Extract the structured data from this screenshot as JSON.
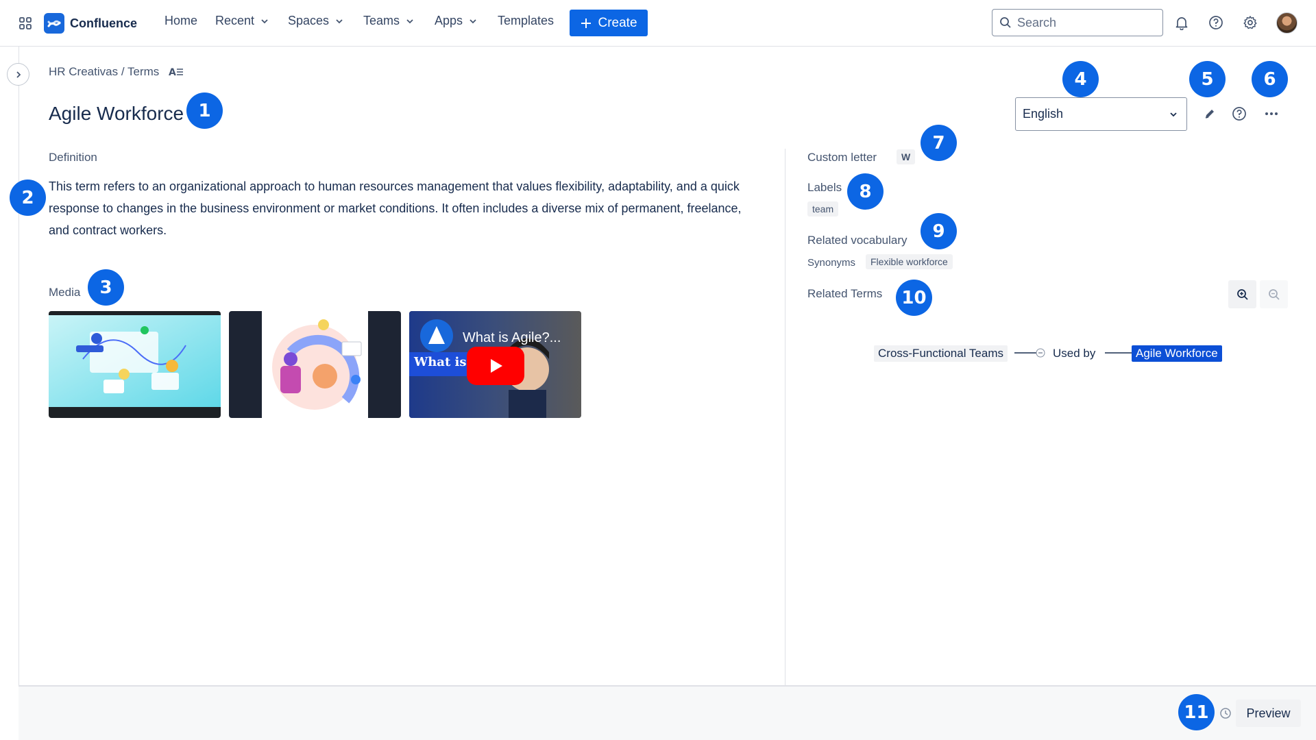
{
  "app": {
    "name": "Confluence"
  },
  "nav": {
    "home": "Home",
    "recent": "Recent",
    "spaces": "Spaces",
    "teams": "Teams",
    "apps": "Apps",
    "templates": "Templates",
    "create": "Create"
  },
  "search": {
    "placeholder": "Search"
  },
  "breadcrumb": {
    "space": "HR Creativas",
    "separator": "/",
    "page": "Terms"
  },
  "page": {
    "title": "Agile Workforce"
  },
  "definition": {
    "label": "Definition",
    "text": "This term refers to an organizational approach to human resources management that values flexibility, adaptability, and a quick response to changes in the business environment or market conditions. It often includes a diverse mix of permanent, freelance, and contract workers."
  },
  "media": {
    "label": "Media",
    "video": {
      "title": "What is Agile?...",
      "overlay_text": "What is A"
    }
  },
  "language": {
    "selected": "English"
  },
  "details": {
    "custom_letter_label": "Custom letter",
    "custom_letter_value": "W",
    "labels_label": "Labels",
    "labels": [
      "team"
    ],
    "related_vocab_label": "Related vocabulary",
    "synonyms_label": "Synonyms",
    "synonyms": [
      "Flexible workforce"
    ],
    "related_terms_label": "Related Terms"
  },
  "graph": {
    "source": "Cross-Functional Teams",
    "relation": "Used by",
    "target": "Agile Workforce"
  },
  "footer": {
    "preview": "Preview"
  },
  "badges": [
    "1",
    "2",
    "3",
    "4",
    "5",
    "6",
    "7",
    "8",
    "9",
    "10",
    "11"
  ],
  "colors": {
    "brand": "#0c66e4",
    "badge": "#0c66e4",
    "target_node": "#0c4fd6"
  }
}
